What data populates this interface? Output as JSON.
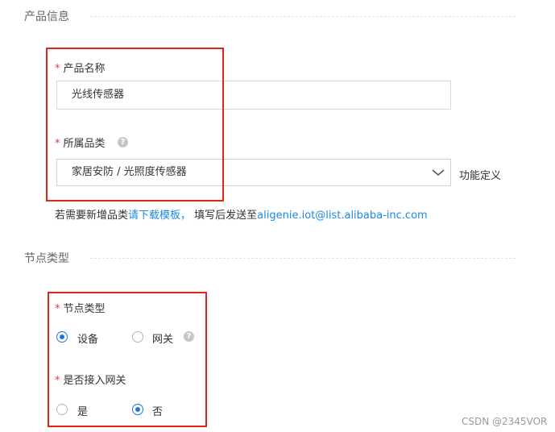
{
  "product_info": {
    "section_title": "产品信息",
    "name_label": "产品名称",
    "name_value": "光线传感器",
    "category_label": "所属品类",
    "category_value": "家居安防 / 光照度传感器",
    "function_def_link": "功能定义",
    "hint_prefix": "若需要新增品类",
    "hint_link": "请下载模板，",
    "hint_middle": " 填写后发送至",
    "hint_email": "aligenie.iot@list.alibaba-inc.com"
  },
  "node_type": {
    "section_title": "节点类型",
    "type_label": "节点类型",
    "options": [
      {
        "label": "设备",
        "checked": true
      },
      {
        "label": "网关",
        "checked": false
      }
    ],
    "gateway_label": "是否接入网关",
    "gateway_options": [
      {
        "label": "是",
        "checked": false
      },
      {
        "label": "否",
        "checked": true
      }
    ]
  },
  "help_icon_glyph": "?",
  "required_mark": "*",
  "watermark": "CSDN @2345VOR",
  "colors": {
    "annotation_red": "#e1251b",
    "link_blue": "#1e88e5",
    "radio_blue": "#1f73d6",
    "required_red": "#e4393c"
  }
}
